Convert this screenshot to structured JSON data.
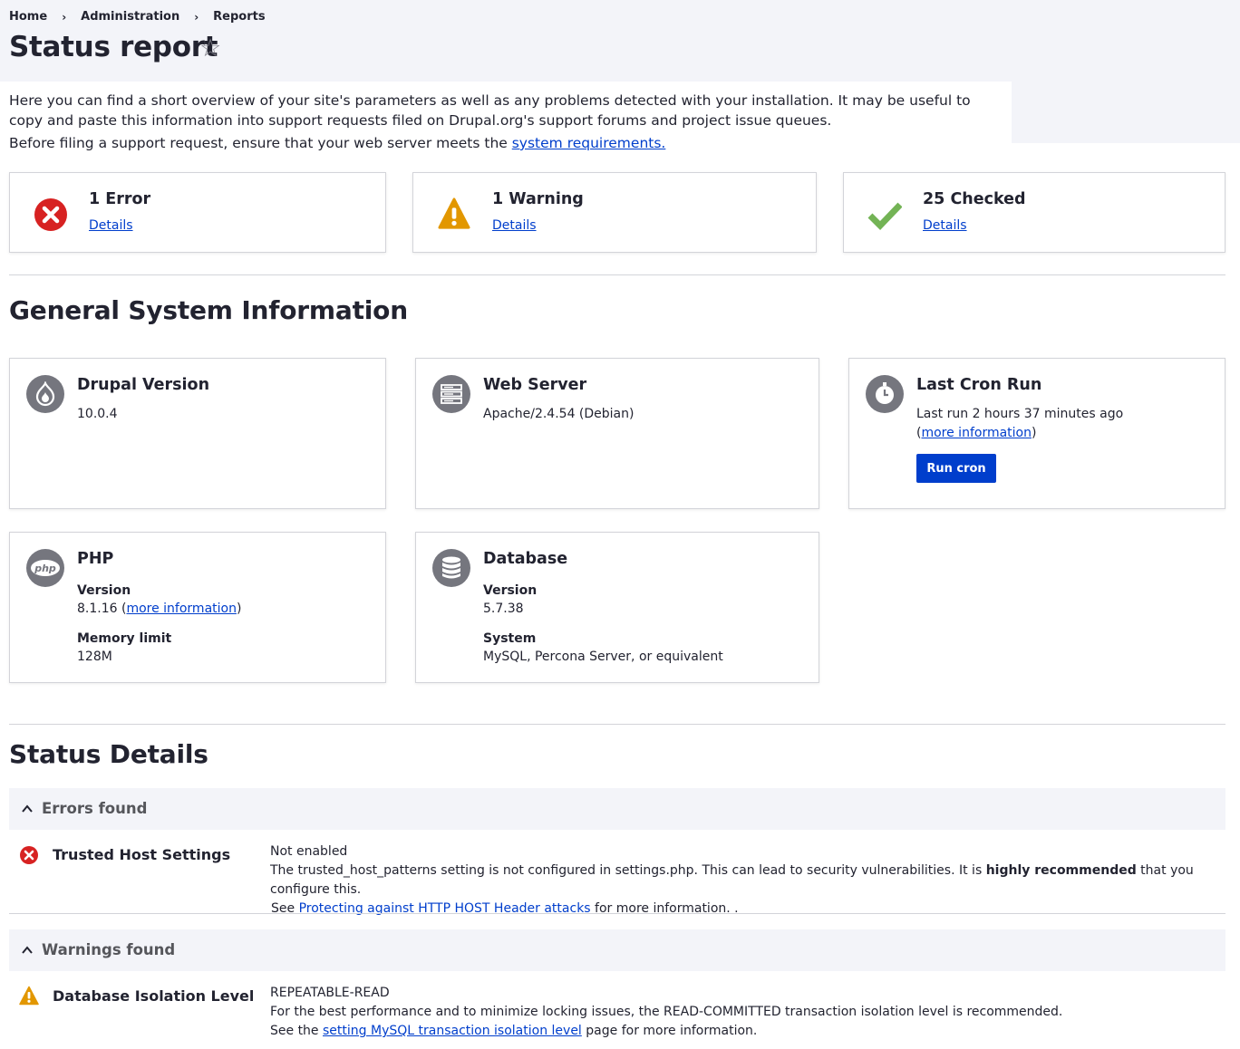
{
  "breadcrumb": {
    "home": "Home",
    "admin": "Administration",
    "reports": "Reports"
  },
  "page_title": "Status report",
  "intro": {
    "text1": "Here you can find a short overview of your site's parameters as well as any problems detected with your installation. It may be useful to copy and paste this information into support requests filed on Drupal.org's support forums and project issue queues.",
    "text2": "Before filing a support request, ensure that your web server meets the ",
    "link": "system requirements."
  },
  "counters": {
    "error": {
      "title": "1 Error",
      "link": "Details",
      "color": "#d72222"
    },
    "warning": {
      "title": "1 Warning",
      "link": "Details",
      "color": "#e29700"
    },
    "checked": {
      "title": "25 Checked",
      "link": "Details",
      "color": "#73b355"
    }
  },
  "general": {
    "heading": "General System Information",
    "drupal": {
      "title": "Drupal Version",
      "value": "10.0.4",
      "icon": "drupal-drop-icon"
    },
    "webserver": {
      "title": "Web Server",
      "value": "Apache/2.4.54 (Debian)",
      "icon": "server-icon"
    },
    "cron": {
      "title": "Last Cron Run",
      "value": "Last run 2 hours 37 minutes ago",
      "paren_open": "(",
      "link": "more information",
      "paren_close": ")",
      "button": "Run cron",
      "icon": "clock-icon"
    },
    "php": {
      "title": "PHP",
      "version_label": "Version",
      "version_value": "8.1.16",
      "version_link": "more information",
      "memory_label": "Memory limit",
      "memory_value": "128M",
      "icon": "php-icon",
      "icon_text": "php"
    },
    "database": {
      "title": "Database",
      "version_label": "Version",
      "version_value": "5.7.38",
      "system_label": "System",
      "system_value": "MySQL, Percona Server, or equivalent",
      "icon": "database-icon"
    }
  },
  "status_details": {
    "heading": "Status Details",
    "errors": {
      "label": "Errors found",
      "item": {
        "title": "Trusted Host Settings",
        "status": "Not enabled",
        "desc_pre": "The trusted_host_patterns setting is not configured in settings.php. This can lead to security vulnerabilities. It is ",
        "desc_bold": "highly recommended",
        "desc_post": " that you configure this.",
        "see_pre": "See ",
        "see_link": "Protecting against HTTP HOST Header attacks",
        "see_post": " for more information.  ."
      }
    },
    "warnings": {
      "label": "Warnings found",
      "item": {
        "title": "Database Isolation Level",
        "status": "REPEATABLE-READ",
        "desc": "For the best performance and to minimize locking issues, the READ-COMMITTED transaction isolation level is recommended.",
        "see_pre": "See the ",
        "see_link": "setting MySQL transaction isolation level",
        "see_post": " page for more information."
      }
    }
  }
}
